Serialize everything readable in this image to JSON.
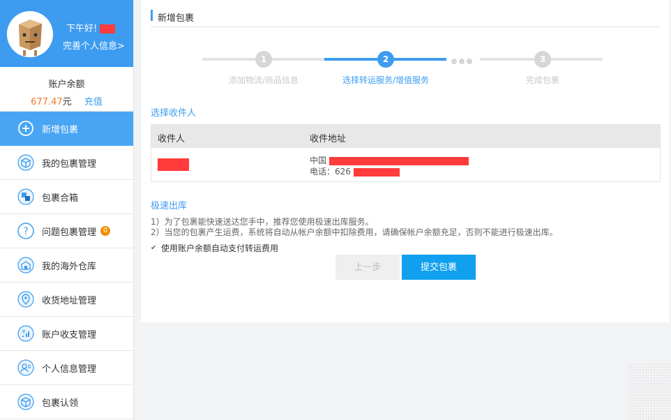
{
  "sidebar": {
    "greeting": "下午好!",
    "complete_profile": "完善个人信息>",
    "balance_label": "账户余额",
    "balance_amount": "677.47",
    "balance_unit": "元",
    "recharge": "充值",
    "items": [
      {
        "label": "新增包裹",
        "icon": "plus-circle-icon",
        "active": true
      },
      {
        "label": "我的包裹管理",
        "icon": "box-icon"
      },
      {
        "label": "包裹合箱",
        "icon": "merge-boxes-icon"
      },
      {
        "label": "问题包裹管理",
        "icon": "question-icon",
        "badge": "0"
      },
      {
        "label": "我的海外仓库",
        "icon": "warehouse-icon"
      },
      {
        "label": "收货地址管理",
        "icon": "location-pin-icon"
      },
      {
        "label": "账户收支管理",
        "icon": "finance-icon"
      },
      {
        "label": "个人信息管理",
        "icon": "user-card-icon"
      },
      {
        "label": "包裹认领",
        "icon": "claim-box-icon"
      }
    ]
  },
  "main": {
    "title": "新增包裹",
    "steps": [
      {
        "num": "1",
        "label": "添加物流/商品信息"
      },
      {
        "num": "2",
        "label": "选择转运服务/增值服务"
      },
      {
        "num": "3",
        "label": "完成包裹"
      }
    ],
    "receiver_section": "选择收件人",
    "table_head": {
      "receiver": "收件人",
      "address": "收件地址"
    },
    "address_prefix": "中国",
    "phone_prefix": "电话：626",
    "express_section": "极速出库",
    "note1": "1）为了包裹能快速送达您手中，推荐您使用极速出库服务。",
    "note2": "2）当您的包裹产生运费，系统将自动从帐户余额中扣除费用，请确保帐户余额充足，否则不能进行极速出库。",
    "auto_pay": "使用账户余额自动支付转运费用",
    "btn_prev": "上一步",
    "btn_submit": "提交包裹"
  },
  "colors": {
    "accent": "#3d9cf0",
    "submit": "#11a0ee",
    "balance": "#f07b2a",
    "badge": "#f08f00",
    "redaction": "#ff3b3b"
  }
}
